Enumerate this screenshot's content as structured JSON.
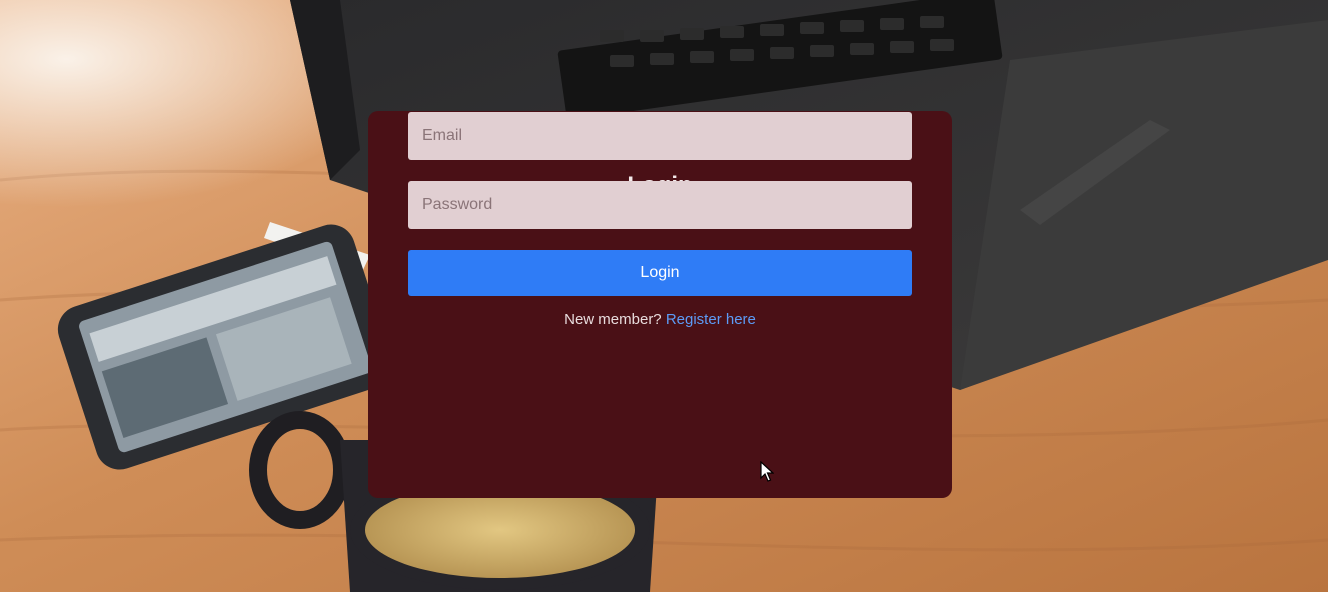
{
  "login_card": {
    "title": "Login",
    "email_placeholder": "Email",
    "password_placeholder": "Password",
    "submit_label": "Login",
    "register_prompt": "New member?",
    "register_link": "Register here"
  },
  "colors": {
    "card_background": "#4a1016",
    "input_background": "#e1cfd2",
    "button_primary": "#2f7cf6",
    "link": "#5d9bf5",
    "desk_wood": "#c98a55"
  },
  "background": {
    "icon": "desk-photo-background"
  }
}
